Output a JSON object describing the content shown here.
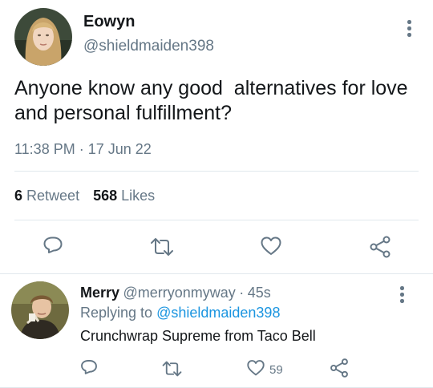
{
  "tweet": {
    "author_name": "Eowyn",
    "author_handle": "@shieldmaiden398",
    "text_line1": "Anyone know any good  alternatives for love",
    "text_line2": "and personal fulfillment?",
    "time": "11:38 PM",
    "separator": "·",
    "date": "17 Jun 22",
    "retweet_count": "6",
    "retweet_label": "Retweet",
    "like_count": "568",
    "like_label": "Likes"
  },
  "reply": {
    "author_name": "Merry",
    "author_handle": "@merryonmyway",
    "separator": "·",
    "age": "45s",
    "replying_prefix": "Replying to",
    "replying_to": "@shieldmaiden398",
    "text": "Crunchwrap Supreme from Taco Bell",
    "like_count": "59"
  },
  "icons": {
    "reply": "reply-icon",
    "retweet": "retweet-icon",
    "like": "heart-icon",
    "share": "share-icon",
    "more": "more-vertical-icon"
  },
  "colors": {
    "text": "#14171a",
    "secondary": "#657786",
    "link": "#1b95e0",
    "divider": "#e1e8ed"
  }
}
